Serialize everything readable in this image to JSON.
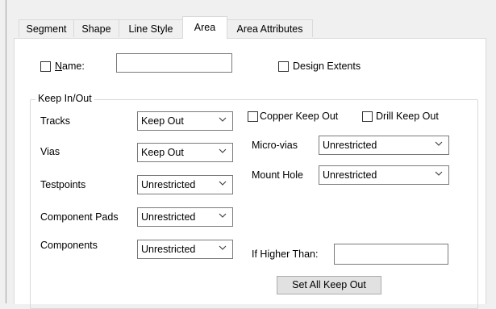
{
  "tabs": [
    {
      "label": "Segment",
      "active": false
    },
    {
      "label": "Shape",
      "active": false
    },
    {
      "label": "Line Style",
      "active": false
    },
    {
      "label": "Area",
      "active": true
    },
    {
      "label": "Area Attributes",
      "active": false
    }
  ],
  "name": {
    "checkbox_mnemonic": "N",
    "checkbox_rest": "ame:",
    "checked": false,
    "value": ""
  },
  "design_extents": {
    "label": "Design Extents",
    "checked": false
  },
  "keep_group": {
    "title": "Keep In/Out"
  },
  "rows_left": [
    {
      "label": "Tracks",
      "value": "Keep Out"
    },
    {
      "label": "Vias",
      "value": "Keep Out"
    },
    {
      "label": "Testpoints",
      "value": "Unrestricted"
    },
    {
      "label": "Component Pads",
      "value": "Unrestricted"
    },
    {
      "label": "Components",
      "value": "Unrestricted"
    }
  ],
  "copper_keep_out": {
    "label": "Copper  Keep Out",
    "checked": false
  },
  "drill_keep_out": {
    "label": "Drill  Keep Out",
    "checked": false
  },
  "micro_vias": {
    "label": "Micro-vias",
    "value": "Unrestricted"
  },
  "mount_hole": {
    "label": "Mount Hole",
    "value": "Unrestricted"
  },
  "if_higher_than": {
    "label": "If Higher Than:",
    "value": ""
  },
  "set_all_button": {
    "label": "Set All Keep Out"
  }
}
